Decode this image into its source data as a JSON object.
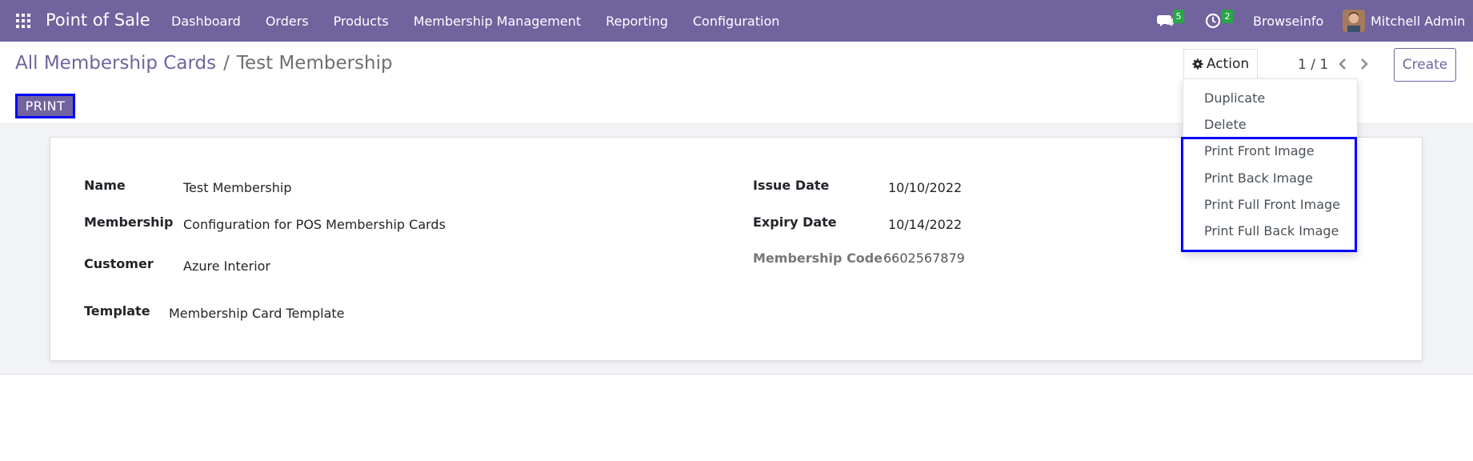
{
  "navbar": {
    "brand": "Point of Sale",
    "menu": [
      "Dashboard",
      "Orders",
      "Products",
      "Membership Management",
      "Reporting",
      "Configuration"
    ],
    "messages_count": "5",
    "activities_count": "2",
    "company": "Browseinfo",
    "user": "Mitchell Admin"
  },
  "control_panel": {
    "breadcrumb_parent": "All Membership Cards",
    "breadcrumb_separator": "/",
    "breadcrumb_current": "Test Membership",
    "action_label": "Action",
    "pager": "1 / 1",
    "create_label": "Create",
    "print_label": "PRINT"
  },
  "form": {
    "name_label": "Name",
    "name_value": "Test Membership",
    "membership_label": "Membership",
    "membership_value": "Configuration for POS Membership Cards",
    "customer_label": "Customer",
    "customer_value": "Azure Interior",
    "template_label": "Template",
    "template_value": "Membership Card Template",
    "issue_date_label": "Issue Date",
    "issue_date_value": "10/10/2022",
    "expiry_date_label": "Expiry Date",
    "expiry_date_value": "10/14/2022",
    "membership_code_label": "Membership Code",
    "membership_code_value": "6602567879"
  },
  "action_menu": [
    "Duplicate",
    "Delete",
    "Print Front Image",
    "Print Back Image",
    "Print Full Front Image",
    "Print Full Back Image"
  ],
  "colors": {
    "brand": "#71639e",
    "highlight": "#0000ff",
    "badge": "#28a745"
  }
}
